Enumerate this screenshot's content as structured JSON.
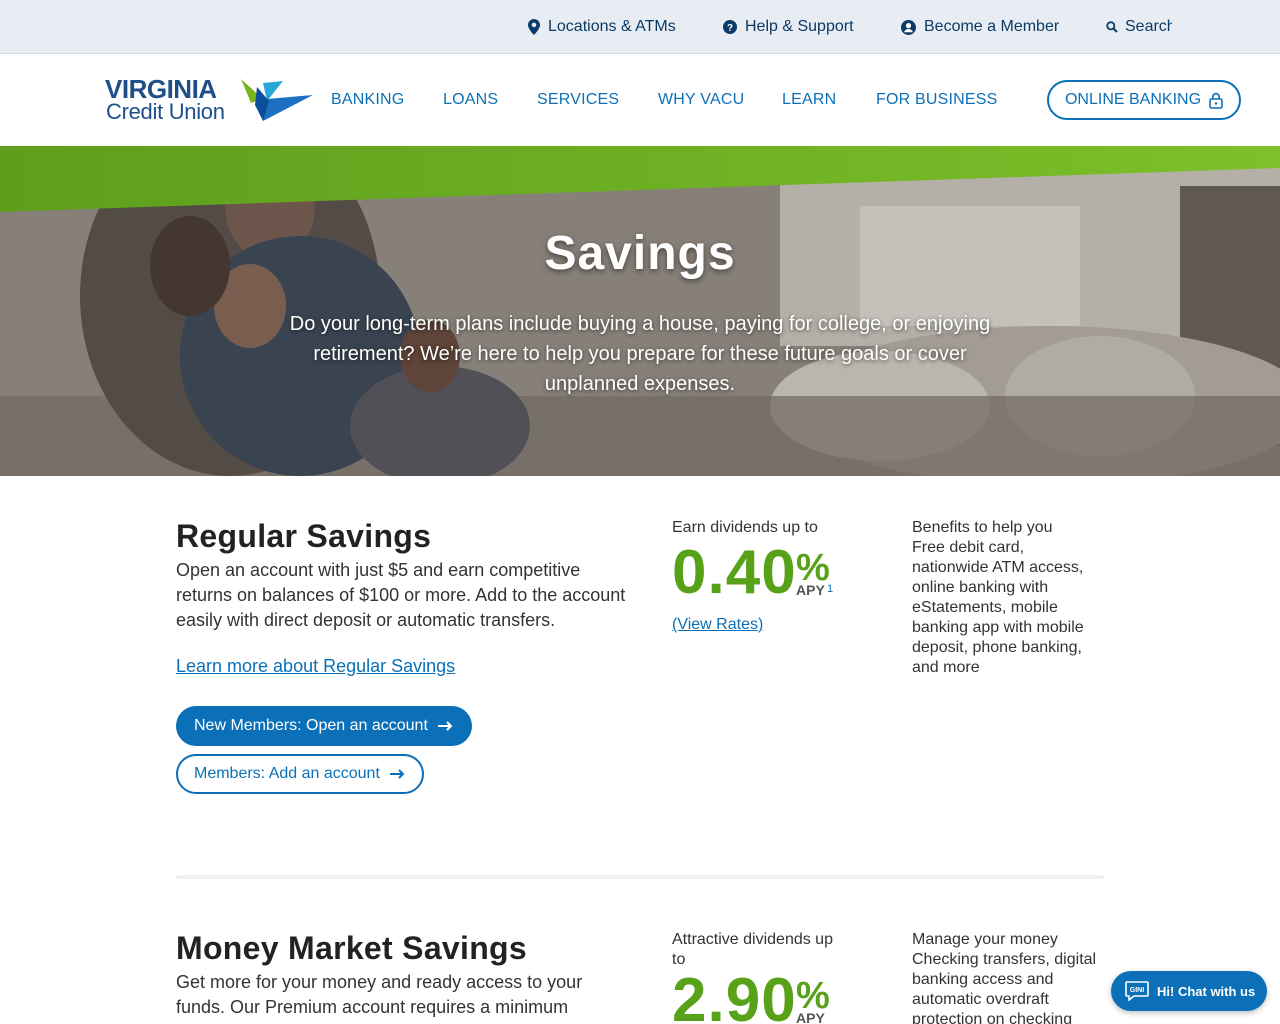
{
  "utility": {
    "locations": "Locations & ATMs",
    "help": "Help & Support",
    "member": "Become a Member",
    "search": "Search"
  },
  "logo": {
    "line1": "VIRGINIA",
    "line2": "Credit Union"
  },
  "nav": {
    "banking": "BANKING",
    "loans": "LOANS",
    "services": "SERVICES",
    "why": "WHY VACU",
    "learn": "LEARN",
    "business": "FOR BUSINESS",
    "online_banking": "ONLINE BANKING"
  },
  "hero": {
    "title": "Savings",
    "text": "Do your long-term plans include buying a house, paying for college, or enjoying retirement? We’re here to help you prepare for these future goals or cover unplanned expenses."
  },
  "regular": {
    "title": "Regular Savings",
    "desc": "Open an account with just $5 and earn competitive returns on balances of $100 or more. Add to the account easily with direct deposit or automatic transfers.",
    "learn": "Learn more about Regular Savings",
    "btn_new": "New Members: Open an account",
    "btn_add": "Members: Add an account",
    "rate_label": "Earn dividends up to",
    "rate": "0.40",
    "pct": "%",
    "apy": "APY",
    "footnote": "1",
    "view_rates": "(View Rates)",
    "benefit_title": "Benefits to help you",
    "benefit_text": "Free debit card, nationwide ATM access, online banking with eStatements, mobile banking app with mobile deposit, phone banking, and more"
  },
  "money_market": {
    "title": "Money Market Savings",
    "desc": "Get more for your money and ready access to your funds. Our Premium account requires a minimum",
    "rate_label": "Attractive dividends up to",
    "rate": "2.90",
    "pct": "%",
    "apy": "APY",
    "benefit_title": "Manage your money",
    "benefit_text": "Checking transfers, digital banking access and automatic overdraft protection on checking"
  },
  "chat": {
    "label": "Hi! Chat with us",
    "icon_text": "GINI"
  },
  "colors": {
    "primary": "#0b70b8",
    "navy": "#1e4f8a",
    "green": "#58a21a",
    "utility_bg": "#e8edf4"
  }
}
